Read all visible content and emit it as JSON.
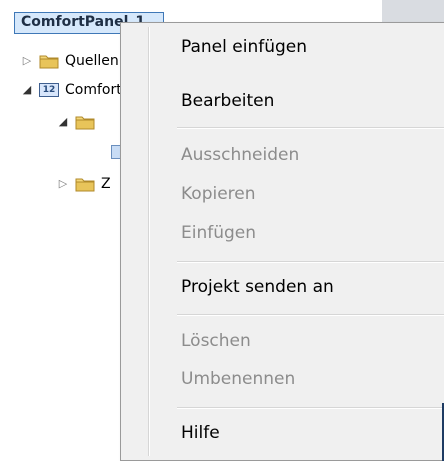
{
  "tree": {
    "root_label": "ComfortPanel_1",
    "items": [
      {
        "label": "Quellen",
        "icon": "folder-icon",
        "expander": "collapsed"
      },
      {
        "label": "ComfortPanel",
        "icon": "device-icon",
        "expander": "expanded",
        "icon_text": "12"
      },
      {
        "label": "",
        "icon": "folder-icon",
        "expander": "expanded"
      },
      {
        "label": "Z",
        "icon": "folder-icon",
        "expander": "collapsed"
      }
    ]
  },
  "context_menu": {
    "items": [
      {
        "label": "Panel einfügen",
        "enabled": true
      },
      {
        "label": "Bearbeiten",
        "enabled": true
      },
      {
        "label": "Ausschneiden",
        "enabled": false
      },
      {
        "label": "Kopieren",
        "enabled": false
      },
      {
        "label": "Einfügen",
        "enabled": false
      },
      {
        "label": "Projekt senden an",
        "enabled": true
      },
      {
        "label": "Löschen",
        "enabled": false
      },
      {
        "label": "Umbenennen",
        "enabled": false
      },
      {
        "label": "Hilfe",
        "enabled": true
      }
    ]
  },
  "colors": {
    "menu_background": "#f0f0f0",
    "disabled_text": "#8c8c8c",
    "selection_border": "#3f78b7",
    "selection_fill": "#d6e8fb",
    "folder_yellow": "#e8c45a"
  }
}
